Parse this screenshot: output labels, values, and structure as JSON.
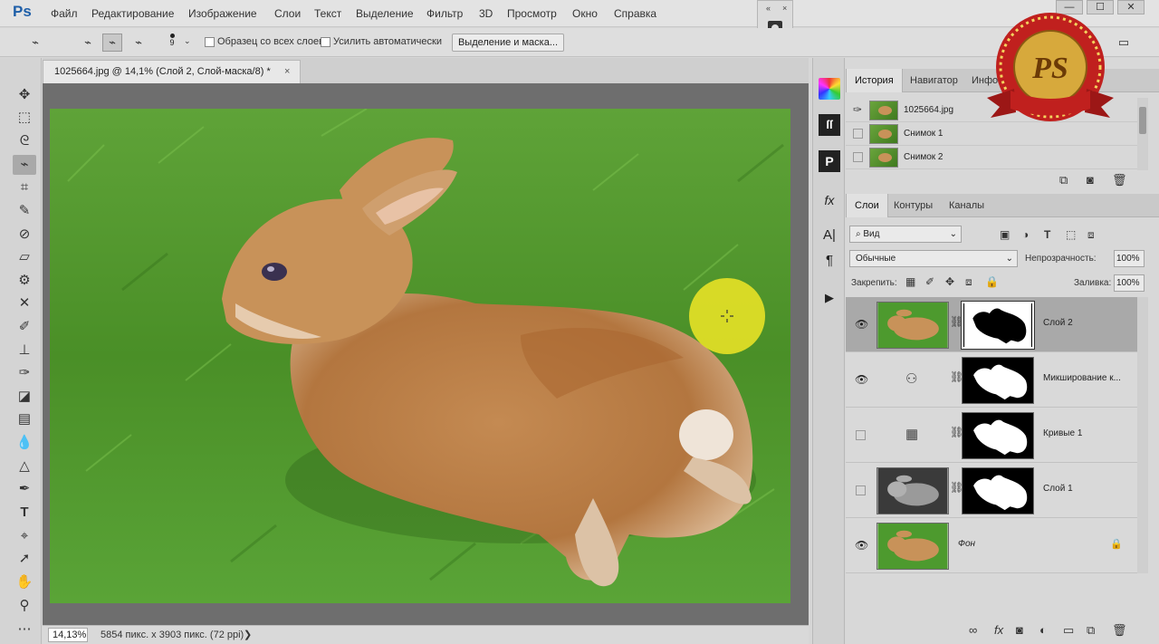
{
  "menu": {
    "logo": "Ps",
    "items": [
      "Файл",
      "Редактирование",
      "Изображение",
      "Слои",
      "Текст",
      "Выделение",
      "Фильтр",
      "3D",
      "Просмотр",
      "Окно",
      "Справка"
    ]
  },
  "window_controls": {
    "minimize": "—",
    "maximize": "☐",
    "close": "✕"
  },
  "options_bar": {
    "brush_size": "9",
    "sample_all_layers": "Образец со всех слоев",
    "auto_enhance": "Усилить автоматически",
    "refine_button": "Выделение и маска..."
  },
  "document": {
    "tab_title": "1025664.jpg @ 14,1% (Слой 2, Слой-маска/8) *",
    "close": "×",
    "zoom": "14,13%",
    "info": "5854 пикс. x 3903 пикс. (72 ppi)",
    "info_arrow": "❯"
  },
  "history_panel": {
    "tabs": [
      "История",
      "Навигатор",
      "Инфо"
    ],
    "items": [
      "1025664.jpg",
      "Снимок 1",
      "Снимок 2"
    ]
  },
  "layers_panel": {
    "tabs": [
      "Слои",
      "Контуры",
      "Каналы"
    ],
    "filter_label": "Вид",
    "blend_mode": "Обычные",
    "opacity_label": "Непрозрачность:",
    "opacity_value": "100%",
    "lock_label": "Закрепить:",
    "fill_label": "Заливка:",
    "fill_value": "100%",
    "layers": [
      {
        "name": "Слой 2",
        "visible": true,
        "selected": true
      },
      {
        "name": "Микширование к...",
        "visible": true,
        "selected": false
      },
      {
        "name": "Кривые 1",
        "visible": false,
        "selected": false
      },
      {
        "name": "Слой 1",
        "visible": false,
        "selected": false
      },
      {
        "name": "Фон",
        "visible": true,
        "selected": false
      }
    ]
  },
  "badge": {
    "text": "PS"
  },
  "colors": {
    "grass": "#4d9a2e",
    "bunny": "#c89259",
    "cursor_highlight": "#f0e626",
    "ps_blue": "#1f5fa8"
  }
}
